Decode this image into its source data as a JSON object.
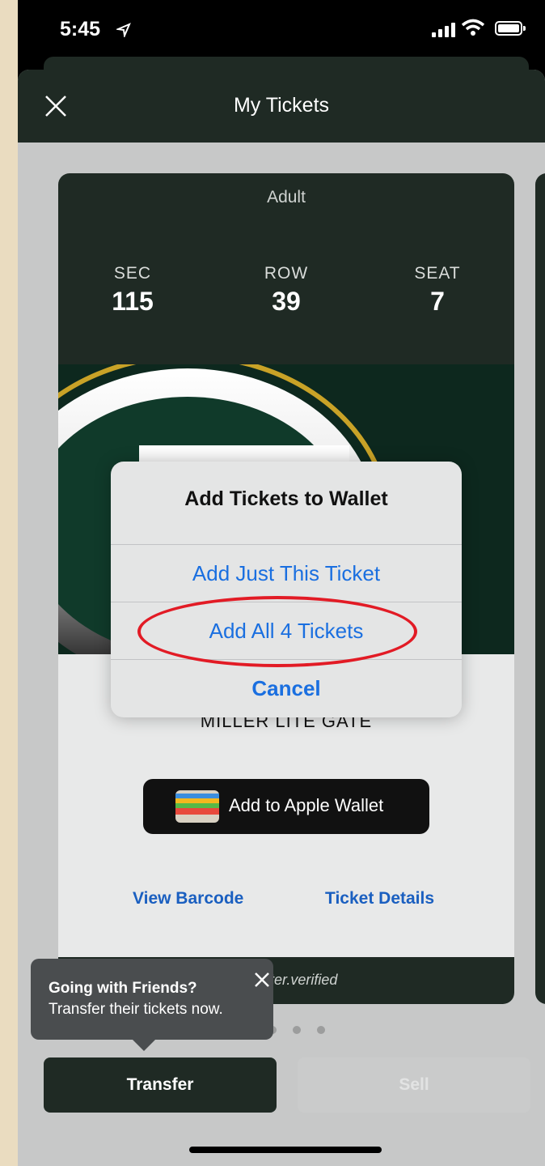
{
  "status_bar": {
    "time": "5:45",
    "location_arrow": "location-arrow-icon"
  },
  "header": {
    "title": "My Tickets",
    "close_icon": "close-icon"
  },
  "ticket": {
    "type": "Adult",
    "section_label": "SEC",
    "section": "115",
    "row_label": "ROW",
    "row": "39",
    "seat_label": "SEAT",
    "seat": "7",
    "gate": "MILLER LITE GATE",
    "wallet_button": "Add to Apple Wallet",
    "view_barcode": "View Barcode",
    "ticket_details": "Ticket Details",
    "verified": "ticketmaster.verified"
  },
  "tooltip": {
    "title": "Going with Friends?",
    "body": "Transfer their tickets now."
  },
  "actions": {
    "transfer": "Transfer",
    "sell": "Sell"
  },
  "alert": {
    "title": "Add Tickets to Wallet",
    "add_one": "Add Just This Ticket",
    "add_all": "Add All 4 Tickets",
    "cancel": "Cancel"
  },
  "colors": {
    "accent": "#1a6fe0",
    "header_bg": "#1f2a24",
    "highlight": "#e21b25"
  }
}
